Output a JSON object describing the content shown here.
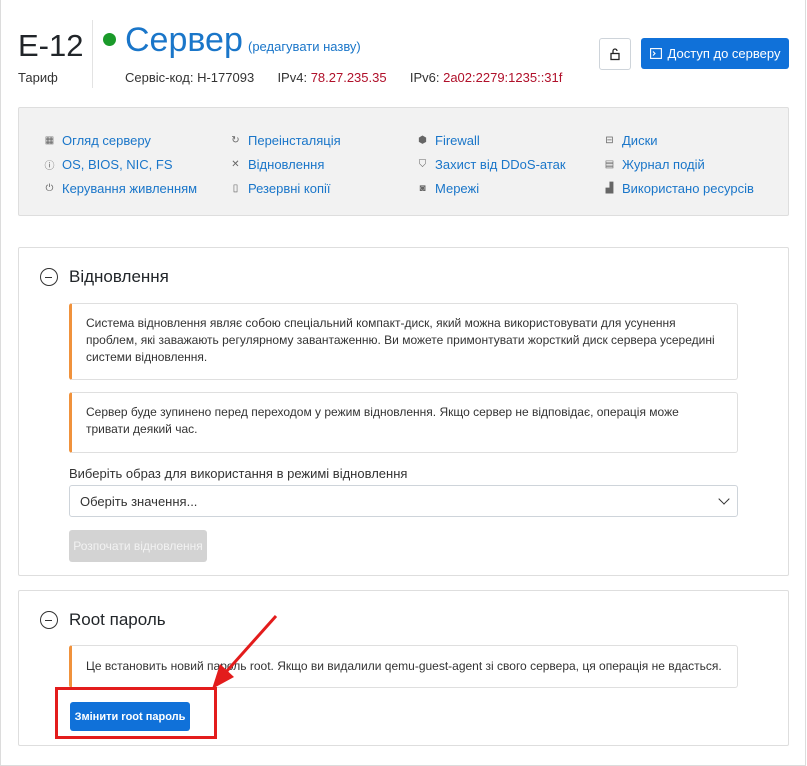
{
  "header": {
    "plan_name": "E-12",
    "plan_label": "Тариф",
    "server_name": "Сервер",
    "rename_link": "(редагувати назву)",
    "service_code_label": "Сервіс-код:",
    "service_code": "H-177093",
    "ipv4_label": "IPv4:",
    "ipv4": "78.27.235.35",
    "ipv6_label": "IPv6:",
    "ipv6": "2a02:2279:1235::31f",
    "status_color": "#1a9a2a",
    "access_button": "Доступ до серверу",
    "lock_icon": "lock-icon"
  },
  "nav": {
    "col1": [
      {
        "label": "Огляд серверу",
        "icon": "dashboard-icon",
        "glyph": "▦"
      },
      {
        "label": "OS, BIOS, NIC, FS",
        "icon": "info-icon",
        "glyph": "ⓘ"
      },
      {
        "label": "Керування живленням",
        "icon": "power-icon",
        "glyph": "⏻"
      }
    ],
    "col2": [
      {
        "label": "Переінсталяція",
        "icon": "reinstall-icon",
        "glyph": "↻"
      },
      {
        "label": "Відновлення",
        "icon": "tools-icon",
        "glyph": "✕"
      },
      {
        "label": "Резервні копії",
        "icon": "file-icon",
        "glyph": "▯"
      }
    ],
    "col3": [
      {
        "label": "Firewall",
        "icon": "firewall-icon",
        "glyph": "⬢"
      },
      {
        "label": "Захист від DDoS-атак",
        "icon": "shield-icon",
        "glyph": "⛉"
      },
      {
        "label": "Мережі",
        "icon": "network-icon",
        "glyph": "◙"
      }
    ],
    "col4": [
      {
        "label": "Диски",
        "icon": "disk-icon",
        "glyph": "⊟"
      },
      {
        "label": "Журнал подій",
        "icon": "log-icon",
        "glyph": "▤"
      },
      {
        "label": "Використано ресурсів",
        "icon": "chart-icon",
        "glyph": "▟"
      }
    ]
  },
  "recovery": {
    "title": "Відновлення",
    "alert1": "Система відновлення являє собою спеціальний компакт-диск, який можна використовувати для усунення проблем, які заважають регулярному завантаженню. Ви можете примонтувати жорсткий диск сервера усередині системи відновлення.",
    "alert2": "Сервер буде зупинено перед переходом у режим відновлення. Якщо сервер не відповідає, операція може тривати деякий час.",
    "select_label": "Виберіть образ для використання в режимі відновлення",
    "select_value": "Оберіть значення...",
    "start_button": "Розпочати відновлення"
  },
  "root": {
    "title": "Root пароль",
    "alert": "Це встановить новий пароль root. Якщо ви видалили qemu-guest-agent зі свого сервера, ця операція не вдасться.",
    "change_button": "Змінити root пароль"
  },
  "colors": {
    "accent": "#1071d9",
    "link": "#1a76c9",
    "warning_border": "#f0923c",
    "annotation": "#e31c1c"
  }
}
